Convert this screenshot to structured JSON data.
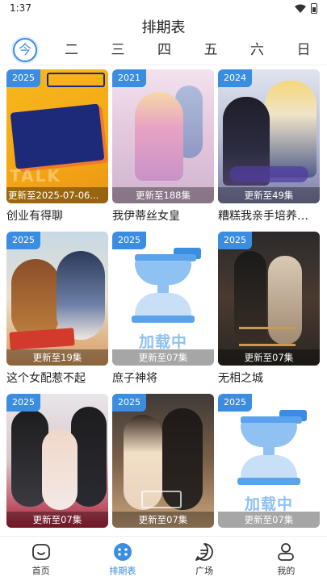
{
  "status_bar": {
    "time": "1:37"
  },
  "header": {
    "title": "排期表"
  },
  "weekdays": [
    {
      "label": "今",
      "active": true
    },
    {
      "label": "二"
    },
    {
      "label": "三"
    },
    {
      "label": "四"
    },
    {
      "label": "五"
    },
    {
      "label": "六"
    },
    {
      "label": "日"
    }
  ],
  "cards": [
    {
      "year": "2025",
      "update": "更新至2025-07-06...",
      "title": "创业有得聊",
      "art": "art-1"
    },
    {
      "year": "2021",
      "update": "更新至188集",
      "title": "我伊蒂丝女皇",
      "art": "art-2"
    },
    {
      "year": "2024",
      "update": "更新至49集",
      "title": "糟糕我亲手培养…",
      "art": "art-3"
    },
    {
      "year": "2025",
      "update": "更新至19集",
      "title": "这个女配惹不起",
      "art": "art-4"
    },
    {
      "year": "2025",
      "update": "更新至07集",
      "title": "庶子神将",
      "art": "art-load",
      "loading_text": "加载中"
    },
    {
      "year": "2025",
      "update": "更新至07集",
      "title": "无相之城",
      "art": "art-6"
    },
    {
      "year": "2025",
      "update": "更新至07集",
      "title": "",
      "art": "art-7"
    },
    {
      "year": "2025",
      "update": "更新至07集",
      "title": "",
      "art": "art-8"
    },
    {
      "year": "2025",
      "update": "更新至07集",
      "title": "",
      "art": "art-load",
      "loading_text": "加载中"
    }
  ],
  "bottom_nav": [
    {
      "label": "首页",
      "icon": "home-icon",
      "active": false
    },
    {
      "label": "排期表",
      "icon": "schedule-icon",
      "active": true
    },
    {
      "label": "广场",
      "icon": "square-icon",
      "active": false
    },
    {
      "label": "我的",
      "icon": "profile-icon",
      "active": false
    }
  ],
  "colors": {
    "accent": "#3a8de0",
    "loading": "#8fc1f2"
  }
}
